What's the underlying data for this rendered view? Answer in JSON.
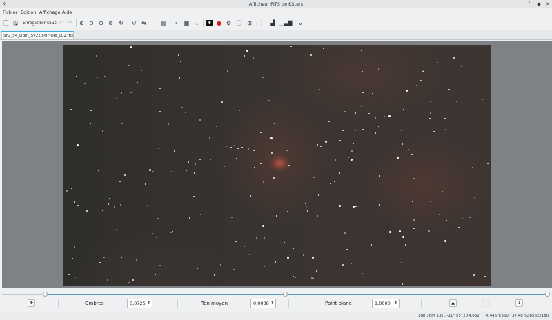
{
  "window": {
    "title": "Afficheur FITS de KStars",
    "buttons": [
      "˅",
      "◆",
      "✕"
    ]
  },
  "menu": [
    "Fichier",
    "Édition",
    "Affichage",
    "Aide"
  ],
  "toolbar": {
    "save_as_label": "Enregistrer sous"
  },
  "tab": {
    "label": "Sh2_54_Light_SV220-H?-OIII_002.fits",
    "close": "×"
  },
  "controls": {
    "shadows_label": "Ombres",
    "shadows_value": "0,0725",
    "midtones_label": "Ton moyen",
    "midtones_value": "0,0038",
    "white_label": "Point blanc",
    "white_value": "1,0000",
    "page_value": "1"
  },
  "status": {
    "coords": "18h 16m 13s , -11° 55' 20\"",
    "value": "4.632",
    "position": "X:446 Y:350",
    "zoom": "37,48 %",
    "size": "3856x2180"
  },
  "colors": {
    "accent": "#3daee9",
    "slider": "#5b9cc7",
    "viewport_bg": "#7e8186"
  }
}
